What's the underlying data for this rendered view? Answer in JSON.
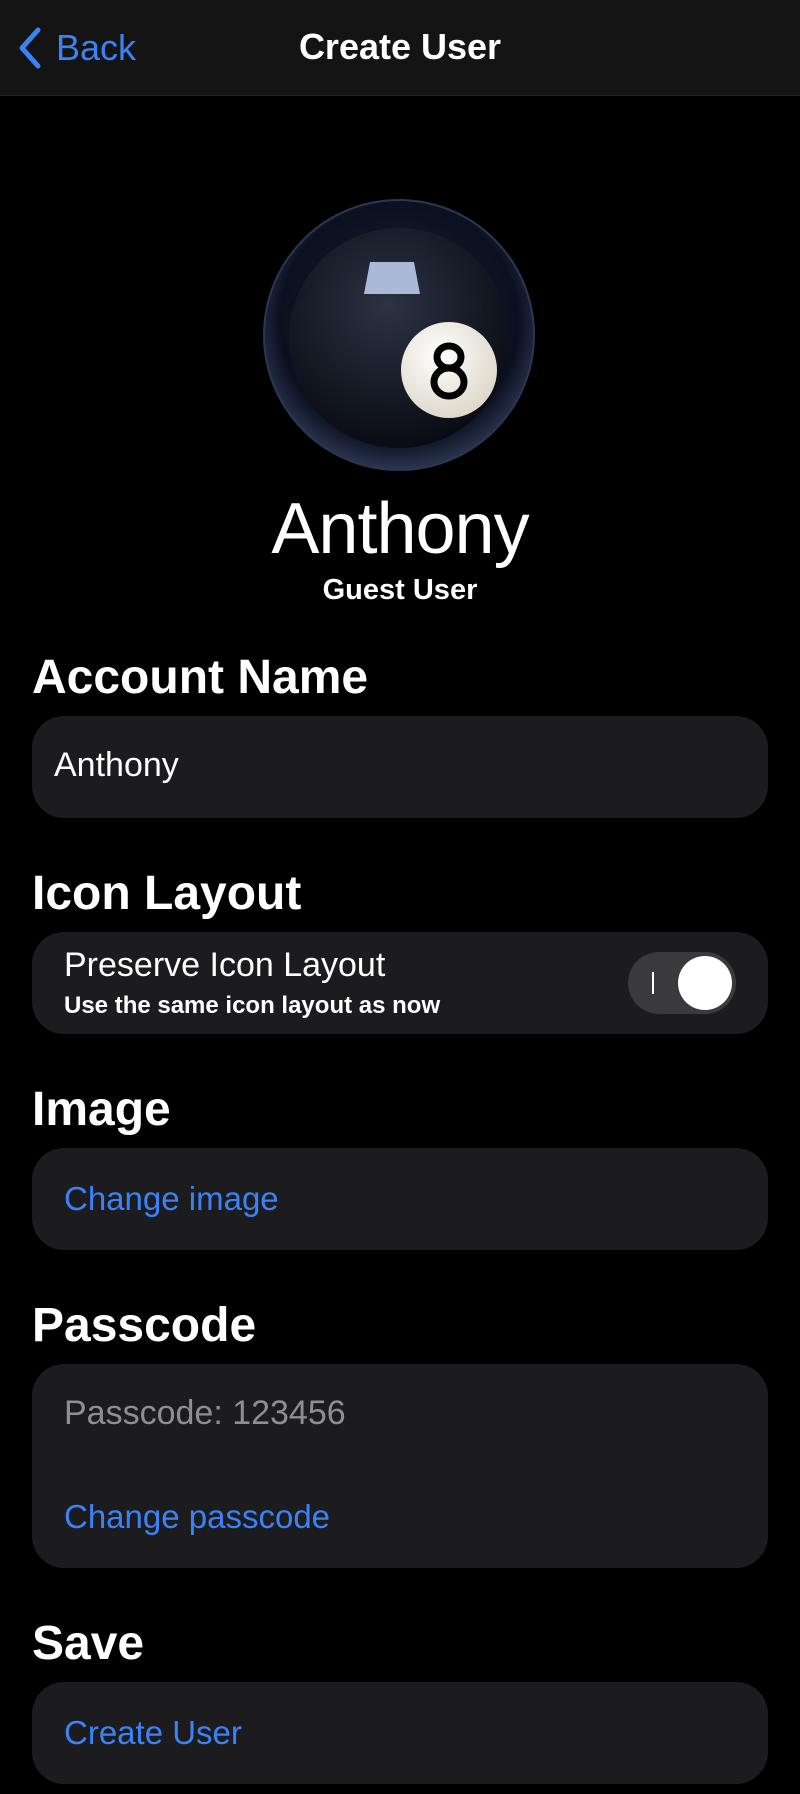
{
  "nav": {
    "back_label": "Back",
    "title": "Create User"
  },
  "profile": {
    "display_name": "Anthony",
    "role": "Guest User",
    "avatar_icon": "eight-ball-icon"
  },
  "account_name": {
    "title": "Account Name",
    "value": "Anthony"
  },
  "icon_layout": {
    "title": "Icon Layout",
    "option_label": "Preserve Icon Layout",
    "option_description": "Use the same icon layout as now",
    "toggle_on": true
  },
  "image": {
    "title": "Image",
    "change_label": "Change image"
  },
  "passcode": {
    "title": "Passcode",
    "current": "Passcode: 123456",
    "change_label": "Change passcode"
  },
  "save": {
    "title": "Save",
    "create_label": "Create User"
  },
  "colors": {
    "accent": "#3b82f6",
    "card": "#1c1c1e",
    "background": "#000000"
  }
}
